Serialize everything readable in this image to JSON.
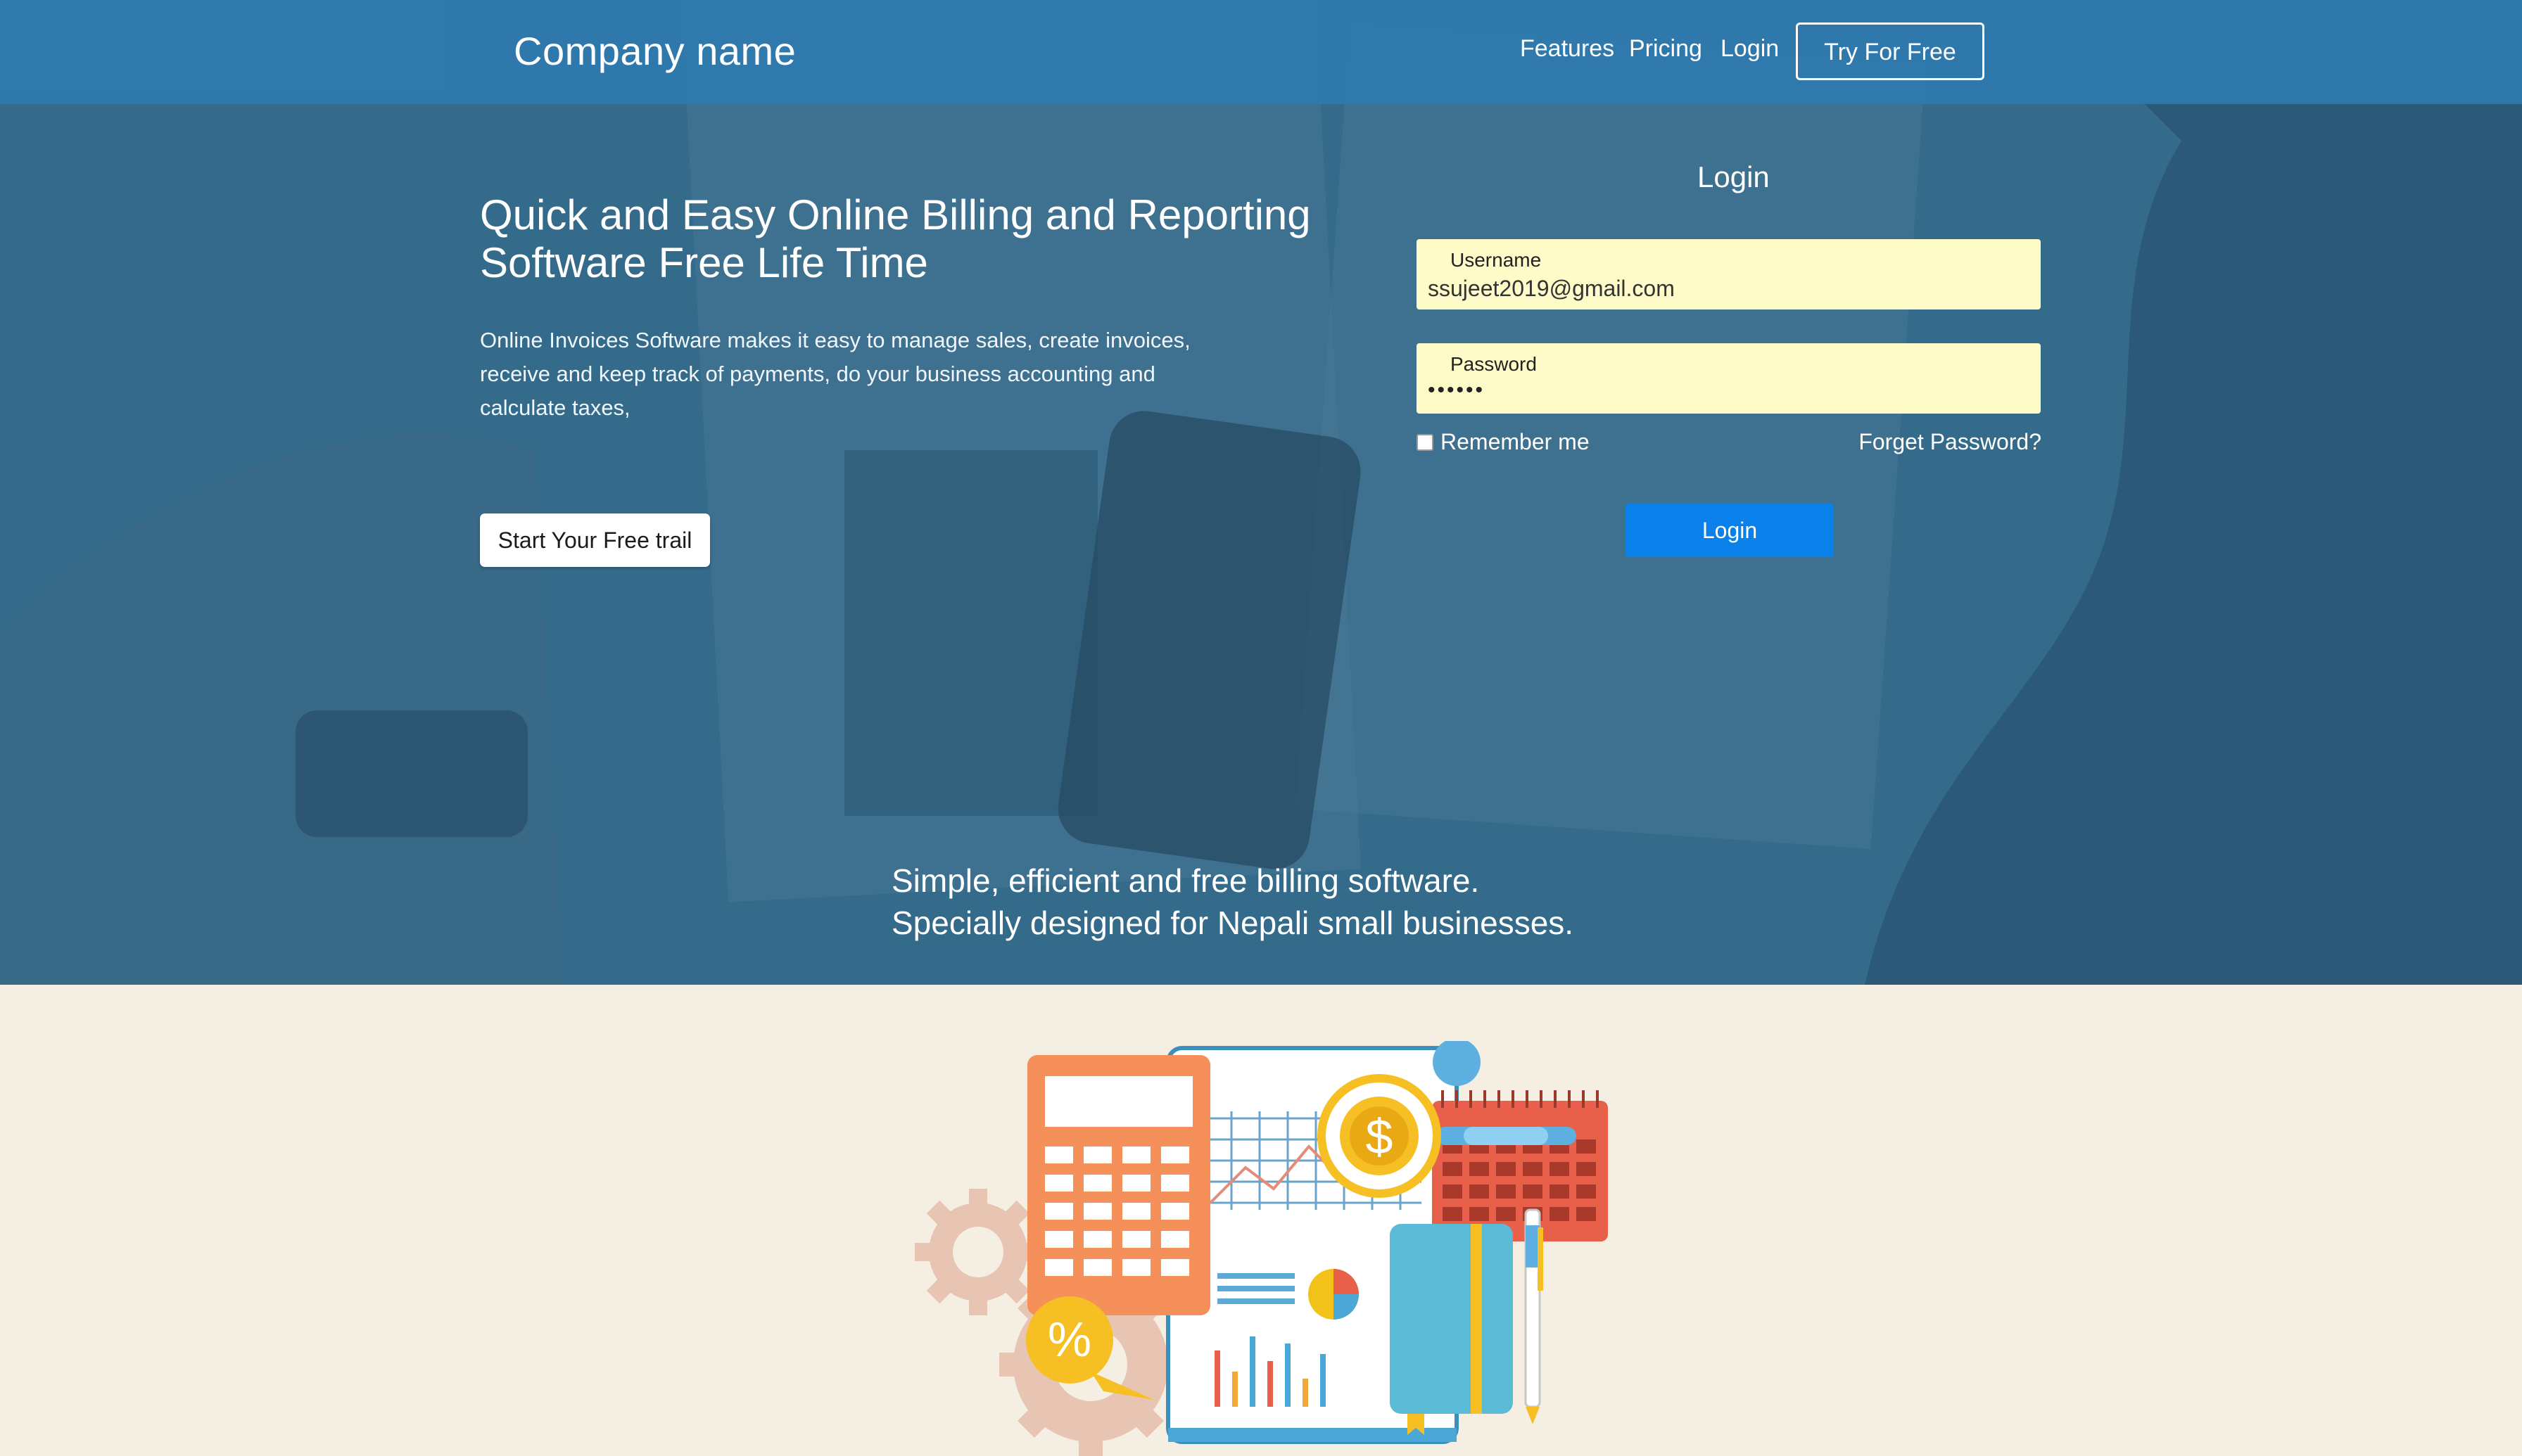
{
  "nav": {
    "brand": "Company name",
    "links": [
      {
        "label": "Features"
      },
      {
        "label": "Pricing"
      },
      {
        "label": "Login"
      }
    ],
    "cta": "Try For Free"
  },
  "hero": {
    "headline_line1": "Quick and Easy Online Billing and Reporting",
    "headline_line2": "Software Free Life Time",
    "description_line1": "Online Invoices Software makes it easy to manage sales, create invoices,",
    "description_line2": "receive and keep track of payments, do your business accounting and",
    "description_line3": "calculate taxes,",
    "trial_button": "Start Your Free trail",
    "tagline_line1": "Simple, efficient and free billing software.",
    "tagline_line2": "Specially designed for Nepali small businesses."
  },
  "login": {
    "title": "Login",
    "username_label": "Username",
    "username_value": "ssujeet2019@gmail.com",
    "password_label": "Password",
    "password_value": "••••••",
    "remember_label": "Remember me",
    "remember_checked": false,
    "forgot_label": "Forget Password?",
    "submit_label": "Login"
  },
  "illustration": {
    "badge_symbol": "$",
    "percent_symbol": "%"
  },
  "colors": {
    "navbar": "#2e7aaf",
    "hero_overlay": "#3b6f8d",
    "login_button": "#0a80ea",
    "field_bg": "#fefbc9",
    "lower_bg": "#f5efe3"
  }
}
